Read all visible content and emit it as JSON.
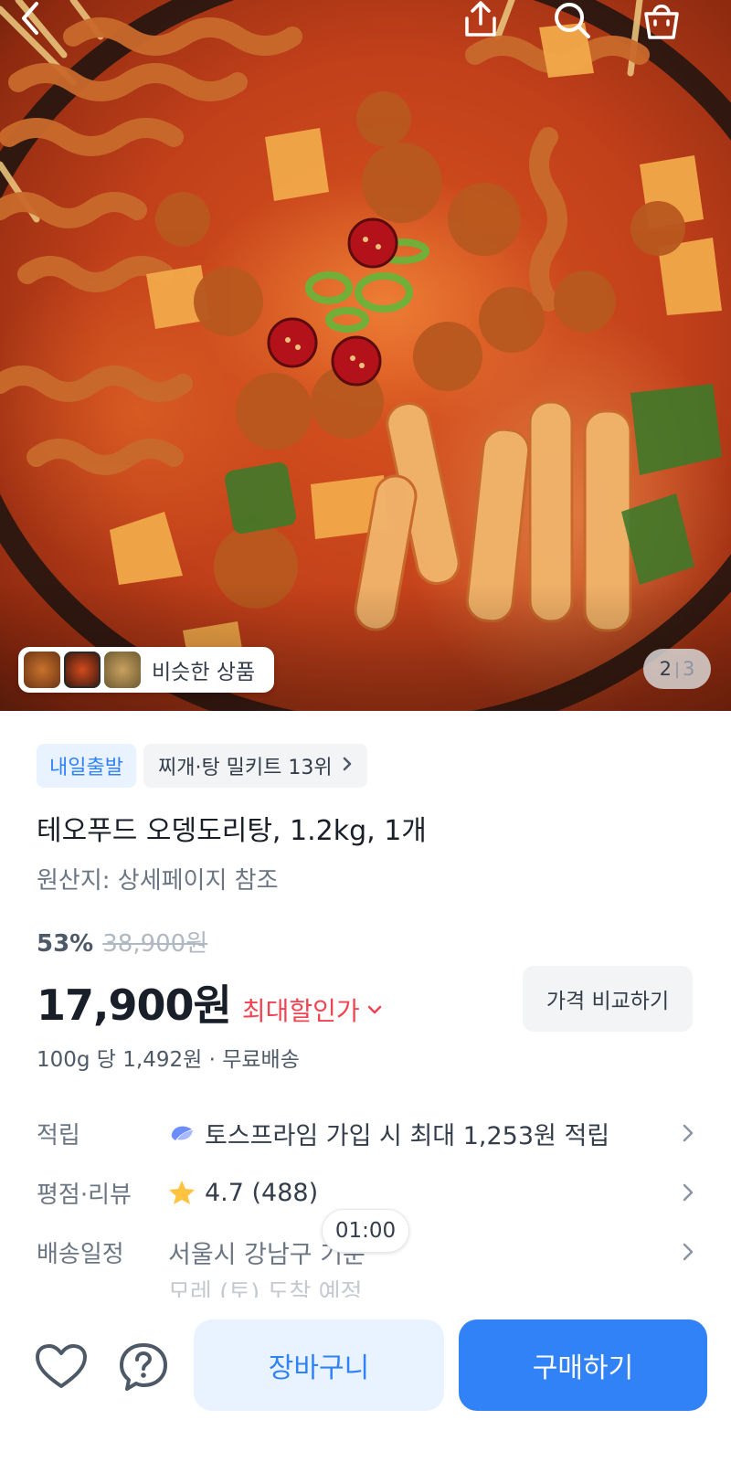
{
  "hero": {
    "image_alt": "odeng dakdoritang hot pot",
    "similar_label": "비슷한 상품",
    "page_current": "2",
    "page_separator": "|",
    "page_total": "3"
  },
  "top_bar": {
    "icons": [
      "back-icon",
      "share-icon",
      "search-icon",
      "shopping-bag-icon"
    ]
  },
  "product": {
    "badge_next_day": "내일출발",
    "badge_rank": "찌개·탕 밀키트 13위",
    "title": "테오푸드 오뎅도리탕, 1.2kg, 1개",
    "origin": "원산지: 상세페이지 참조",
    "discount_rate": "53%",
    "original_price": "38,900원",
    "sale_price": "17,900원",
    "max_discount_label": "최대할인가",
    "compare_label": "가격 비교하기",
    "unit_price": "100g 당 1,492원 · 무료배송"
  },
  "info_rows": {
    "points_label": "적립",
    "points_value": "토스프라임 가입 시 최대 1,253원 적립",
    "rating_label": "평점·리뷰",
    "rating_value": "4.7 (488)",
    "delivery_label": "배송일정",
    "delivery_value": "서울시 강남구 기준",
    "delivery_sub": "모레 (토) 도착 예정"
  },
  "time_bubble": "01:00",
  "bottom_bar": {
    "cart_label": "장바구니",
    "buy_label": "구매하기"
  },
  "colors": {
    "accent": "#3182f6",
    "accent_light": "#e8f3ff",
    "discount_red": "#f04452",
    "text_primary": "#191f28",
    "text_secondary": "#6b7684"
  }
}
